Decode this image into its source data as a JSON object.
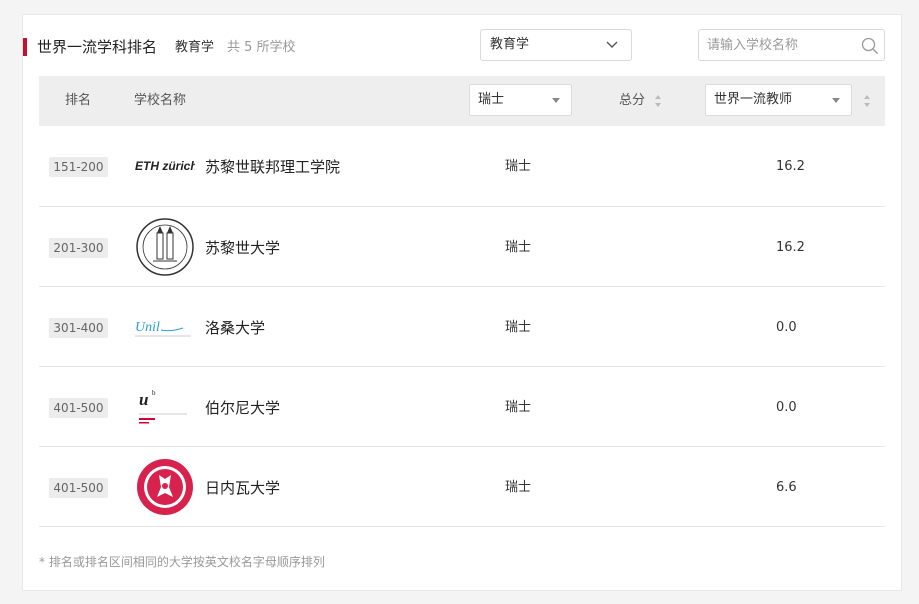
{
  "header": {
    "title": "世界一流学科排名",
    "subject": "教育学",
    "count_text": "共 5 所学校"
  },
  "subject_select": {
    "value": "教育学"
  },
  "search": {
    "placeholder": "请输入学校名称"
  },
  "table": {
    "headers": {
      "rank": "排名",
      "name": "学校名称",
      "country_filter": "瑞士",
      "total": "总分",
      "indicator_filter": "世界一流教师"
    },
    "rows": [
      {
        "rank": "151-200",
        "name": "苏黎世联邦理工学院",
        "country": "瑞士",
        "score": "16.2",
        "logo_text": "ETH zürich"
      },
      {
        "rank": "201-300",
        "name": "苏黎世大学",
        "country": "瑞士",
        "score": "16.2",
        "logo_text": ""
      },
      {
        "rank": "301-400",
        "name": "洛桑大学",
        "country": "瑞士",
        "score": "0.0",
        "logo_text": "Unil"
      },
      {
        "rank": "401-500",
        "name": "伯尔尼大学",
        "country": "瑞士",
        "score": "0.0",
        "logo_text": "u"
      },
      {
        "rank": "401-500",
        "name": "日内瓦大学",
        "country": "瑞士",
        "score": "6.6",
        "logo_text": ""
      }
    ]
  },
  "footnote": "* 排名或排名区间相同的大学按英文校名字母顺序排列",
  "colors": {
    "accent": "#c8102e",
    "header_bg": "#eeeeee",
    "badge_bg": "#ececec",
    "unil_blue": "#2a9fd6",
    "bern_red": "#d4003c",
    "geneva_red": "#d6224c"
  },
  "icons": {
    "search": "search-icon",
    "chevron": "chevron-down-icon",
    "sort": "sort-icon"
  }
}
